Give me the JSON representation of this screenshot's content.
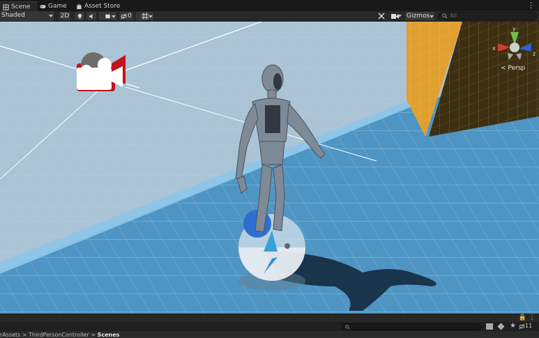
{
  "tabs": [
    {
      "label": "Scene",
      "icon": "scene-icon",
      "active": true
    },
    {
      "label": "Game",
      "icon": "gamepad-icon",
      "active": false
    },
    {
      "label": "Asset Store",
      "icon": "shopping-bag-icon",
      "active": false
    }
  ],
  "toolbar": {
    "shading_mode": "Shaded",
    "mode_2d": "2D",
    "hidden_count": "0",
    "gizmos_label": "Gizmos",
    "search_placeholder": "All"
  },
  "scene": {
    "persp_label": "< Persp",
    "gizmo_axes": [
      "y",
      "x",
      "z"
    ]
  },
  "bottom": {
    "breadcrumb": [
      "rAssets",
      "ThirdPersonController",
      "Scenes"
    ],
    "hidden_packages_count": "11"
  },
  "colors": {
    "sky": "#a9c3d6",
    "floor": "#4d93c2",
    "wall": "#e0a030",
    "panel": "#282828"
  }
}
